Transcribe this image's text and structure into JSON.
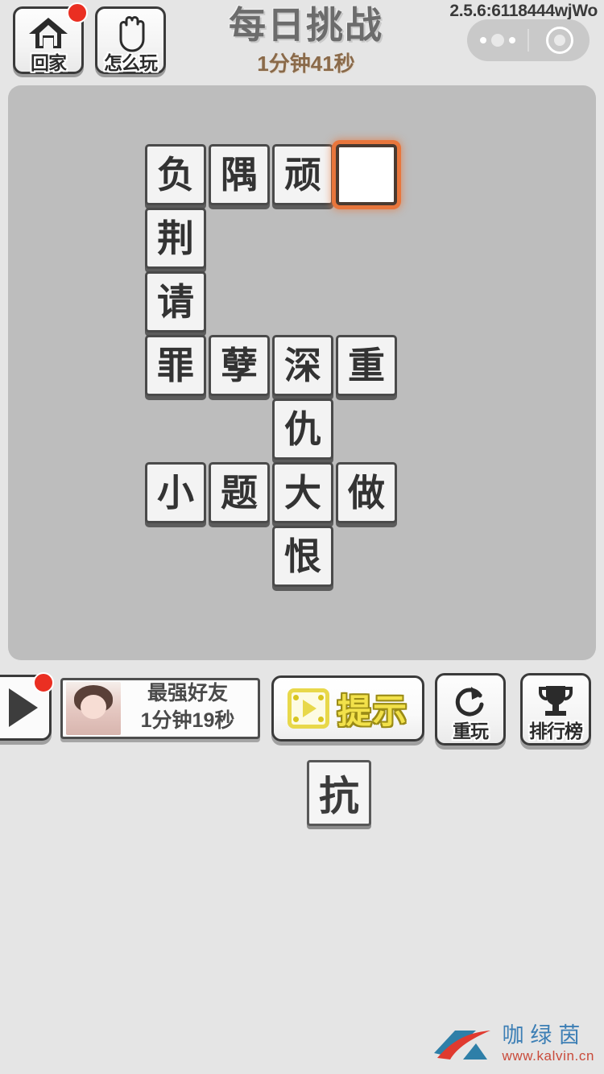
{
  "header": {
    "home_button": {
      "label": "回家",
      "icon": "home-icon",
      "badge": true
    },
    "howto_button": {
      "label": "怎么玩",
      "icon": "hand-icon"
    },
    "title": "每日挑战",
    "timer": "1分钟41秒",
    "version": "2.5.6:6118444wjWo",
    "capsule": {
      "menu_icon": "more-dots-icon",
      "target_icon": "target-circle-icon"
    }
  },
  "board": {
    "background_color": "#bdbdbd",
    "highlight_color": "#e8763c",
    "tiles": [
      {
        "char": "负",
        "col": 0,
        "row": 0,
        "empty": false
      },
      {
        "char": "隅",
        "col": 1,
        "row": 0,
        "empty": false
      },
      {
        "char": "顽",
        "col": 2,
        "row": 0,
        "empty": false
      },
      {
        "char": "",
        "col": 3,
        "row": 0,
        "empty": true
      },
      {
        "char": "荆",
        "col": 0,
        "row": 1,
        "empty": false
      },
      {
        "char": "请",
        "col": 0,
        "row": 2,
        "empty": false
      },
      {
        "char": "罪",
        "col": 0,
        "row": 3,
        "empty": false
      },
      {
        "char": "孽",
        "col": 1,
        "row": 3,
        "empty": false
      },
      {
        "char": "深",
        "col": 2,
        "row": 3,
        "empty": false
      },
      {
        "char": "重",
        "col": 3,
        "row": 3,
        "empty": false
      },
      {
        "char": "仇",
        "col": 2,
        "row": 4,
        "empty": false
      },
      {
        "char": "小",
        "col": 0,
        "row": 5,
        "empty": false
      },
      {
        "char": "题",
        "col": 1,
        "row": 5,
        "empty": false
      },
      {
        "char": "大",
        "col": 2,
        "row": 5,
        "empty": false
      },
      {
        "char": "做",
        "col": 3,
        "row": 5,
        "empty": false
      },
      {
        "char": "恨",
        "col": 2,
        "row": 6,
        "empty": false
      }
    ]
  },
  "bottom": {
    "play_button": {
      "icon": "play-triangle-icon",
      "badge": true
    },
    "friend_card": {
      "title": "最强好友",
      "time": "1分钟19秒",
      "avatar": "friend-avatar"
    },
    "hint_button": {
      "label": "提示",
      "icon": "video-ad-icon",
      "color": "#f2e14a"
    },
    "replay_button": {
      "label": "重玩",
      "icon": "refresh-icon"
    },
    "rank_button": {
      "label": "排行榜",
      "icon": "trophy-icon"
    }
  },
  "drag_tile": {
    "char": "抗"
  },
  "watermark": {
    "name": "咖绿茵",
    "url": "www.kalvin.cn"
  }
}
